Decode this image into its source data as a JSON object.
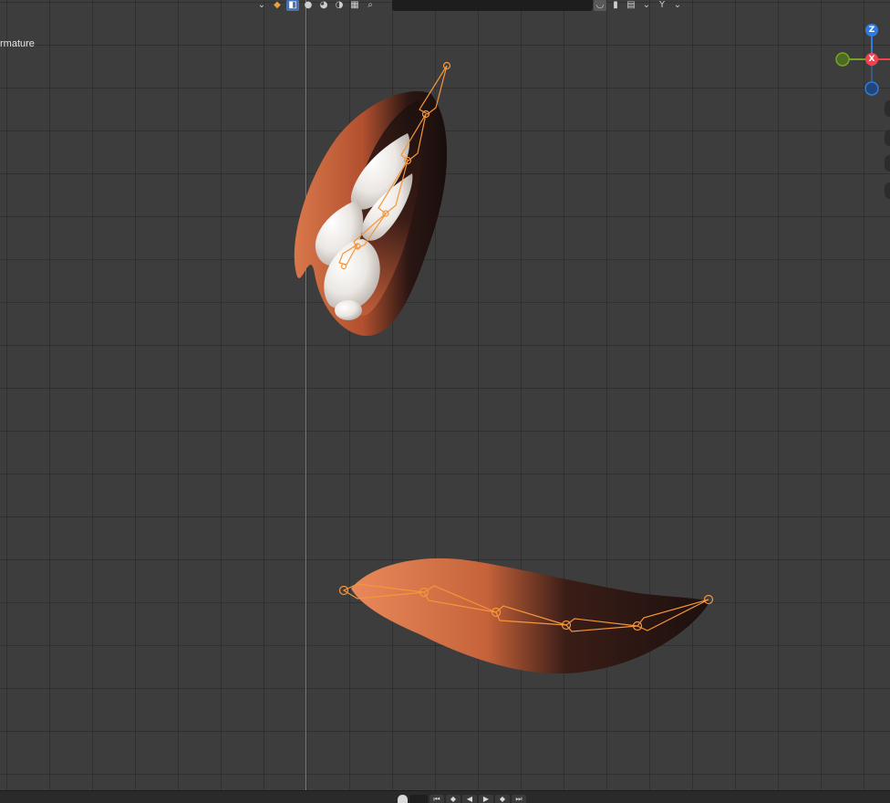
{
  "viewport": {
    "active_object_label": "rmature"
  },
  "header": {
    "left_dropdown_icon": "chevron-down-icon",
    "shading_modes": [
      {
        "name": "wireframe-icon",
        "glyph": "◧",
        "active": true
      },
      {
        "name": "solid-shading-icon",
        "glyph": "●",
        "active": false
      },
      {
        "name": "material-preview-icon",
        "glyph": "◕",
        "active": false
      },
      {
        "name": "rendered-shading-icon",
        "glyph": "◑",
        "active": false
      },
      {
        "name": "layout-icon",
        "glyph": "▦",
        "active": false
      }
    ],
    "search_icon": "⌕",
    "right_tools": [
      {
        "name": "overlay-icon",
        "glyph": "◡"
      },
      {
        "name": "bookmark-icon",
        "glyph": "▮"
      },
      {
        "name": "editor-type-icon",
        "glyph": "▤"
      },
      {
        "name": "pin-tool-icon",
        "glyph": "Y"
      }
    ]
  },
  "gizmo": {
    "z_label": "Z",
    "x_label": "X",
    "colors": {
      "x": "#f5414f",
      "y": "#76a325",
      "z": "#2f7ce0"
    }
  },
  "colors": {
    "bone_orange": "#f6963a",
    "skin_orange": "#d46a40",
    "fur_dark": "#231412",
    "claw_white": "#ece9e6",
    "grid_background": "#3d3d3d"
  },
  "timeline": {
    "controls": [
      {
        "name": "jump-start-icon",
        "glyph": "⏮"
      },
      {
        "name": "prev-keyframe-icon",
        "glyph": "◆"
      },
      {
        "name": "play-reverse-icon",
        "glyph": "◀"
      },
      {
        "name": "play-icon",
        "glyph": "▶"
      },
      {
        "name": "next-keyframe-icon",
        "glyph": "◆"
      },
      {
        "name": "jump-end-icon",
        "glyph": "⏭"
      }
    ]
  }
}
